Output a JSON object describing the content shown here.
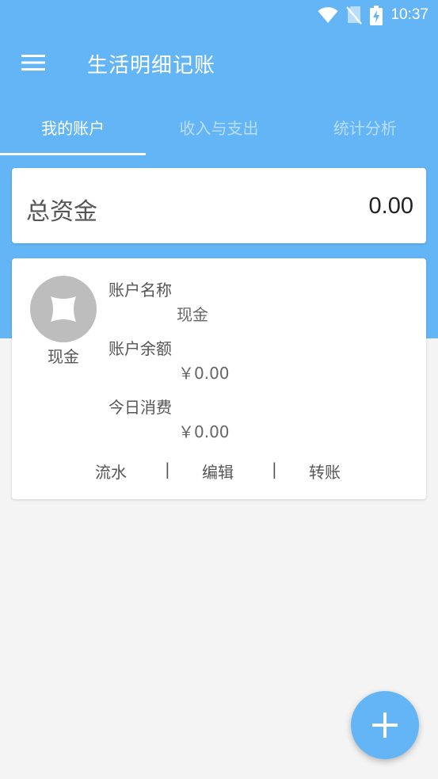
{
  "status_bar": {
    "time": "10:37",
    "icons": [
      "wifi-icon",
      "no-sim-icon",
      "battery-charging-icon"
    ]
  },
  "app_bar": {
    "menu_icon": "menu-icon",
    "title": "生活明细记账"
  },
  "tabs": [
    {
      "label": "我的账户",
      "active": true
    },
    {
      "label": "收入与支出",
      "active": false
    },
    {
      "label": "统计分析",
      "active": false
    }
  ],
  "total": {
    "label": "总资金",
    "value": "0.00"
  },
  "account": {
    "avatar_label": "现金",
    "name_label": "账户名称",
    "name_value": "现金",
    "balance_label": "账户余额",
    "balance_value": "￥0.00",
    "today_label": "今日消费",
    "today_value": "￥0.00",
    "actions": {
      "flow": "流水",
      "edit": "编辑",
      "transfer": "转账",
      "separator": "|"
    }
  },
  "fab": {
    "icon": "plus-icon"
  },
  "colors": {
    "primary": "#64b5f6",
    "background": "#f4f4f4",
    "card": "#ffffff",
    "avatar": "#bdbdbd"
  }
}
